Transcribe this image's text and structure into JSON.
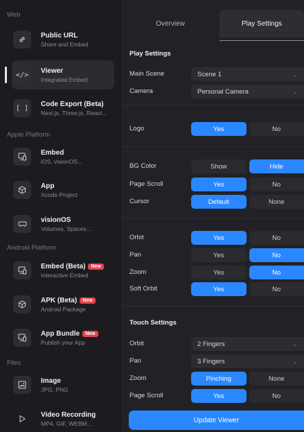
{
  "sidebar": {
    "sections": {
      "web": "Web",
      "apple": "Apple Platform",
      "android": "Android Platform",
      "files": "Files"
    },
    "items": [
      {
        "title": "Public URL",
        "subtitle": "Share and Embed",
        "icon": "link-icon"
      },
      {
        "title": "Viewer",
        "subtitle": "Integrated Embed",
        "icon": "code-icon"
      },
      {
        "title": "Code Export (Beta)",
        "subtitle": "Next.js, Three.js, React...",
        "icon": "brackets-icon"
      },
      {
        "title": "Embed",
        "subtitle": "iOS, visionOS...",
        "icon": "device-icon"
      },
      {
        "title": "App",
        "subtitle": "Xcode Project",
        "icon": "cube-icon"
      },
      {
        "title": "visionOS",
        "subtitle": "Volumes, Spaces...",
        "icon": "vision-pro-icon"
      },
      {
        "title": "Embed (Beta)",
        "subtitle": "Interactive Embed",
        "icon": "device-icon",
        "badge": "New"
      },
      {
        "title": "APK (Beta)",
        "subtitle": "Android Package",
        "icon": "cube-icon",
        "badge": "New"
      },
      {
        "title": "App Bundle",
        "subtitle": "Publish your App",
        "icon": "device-icon",
        "badge": "New"
      },
      {
        "title": "Image",
        "subtitle": "JPG, PNG",
        "icon": "image-icon"
      },
      {
        "title": "Video Recording",
        "subtitle": "MP4, GIF, WEBM...",
        "icon": "play-icon"
      }
    ],
    "active_item": "Viewer"
  },
  "tabs": {
    "overview": "Overview",
    "play_settings": "Play Settings",
    "active": "Play Settings"
  },
  "play_settings": {
    "heading": "Play Settings",
    "main_scene": {
      "label": "Main Scene",
      "value": "Scene 1"
    },
    "camera": {
      "label": "Camera",
      "value": "Personal Camera"
    },
    "logo": {
      "label": "Logo",
      "options": [
        "Yes",
        "No"
      ],
      "selected": "Yes"
    },
    "bg_color": {
      "label": "BG Color",
      "options": [
        "Show",
        "Hide"
      ],
      "selected": "Hide"
    },
    "page_scroll": {
      "label": "Page Scroll",
      "options": [
        "Yes",
        "No"
      ],
      "selected": "Yes"
    },
    "cursor": {
      "label": "Cursor",
      "options": [
        "Default",
        "None"
      ],
      "selected": "Default"
    },
    "orbit": {
      "label": "Orbit",
      "options": [
        "Yes",
        "No"
      ],
      "selected": "Yes"
    },
    "pan": {
      "label": "Pan",
      "options": [
        "Yes",
        "No"
      ],
      "selected": "No"
    },
    "zoom": {
      "label": "Zoom",
      "options": [
        "Yes",
        "No"
      ],
      "selected": "No"
    },
    "soft_orbit": {
      "label": "Soft Orbit",
      "options": [
        "Yes",
        "No"
      ],
      "selected": "Yes"
    }
  },
  "touch_settings": {
    "heading": "Touch Settings",
    "orbit": {
      "label": "Orbit",
      "value": "2 Fingers"
    },
    "pan": {
      "label": "Pan",
      "value": "3 Fingers"
    },
    "zoom": {
      "label": "Zoom",
      "options": [
        "Pinching",
        "None"
      ],
      "selected": "Pinching"
    },
    "page_scroll": {
      "label": "Page Scroll",
      "options": [
        "Yes",
        "No"
      ],
      "selected": "Yes"
    }
  },
  "update_button": "Update Viewer",
  "colors": {
    "accent": "#2b87ff",
    "badge": "#e4444f",
    "panel": "#222226",
    "sidebar": "#1c1c20"
  }
}
